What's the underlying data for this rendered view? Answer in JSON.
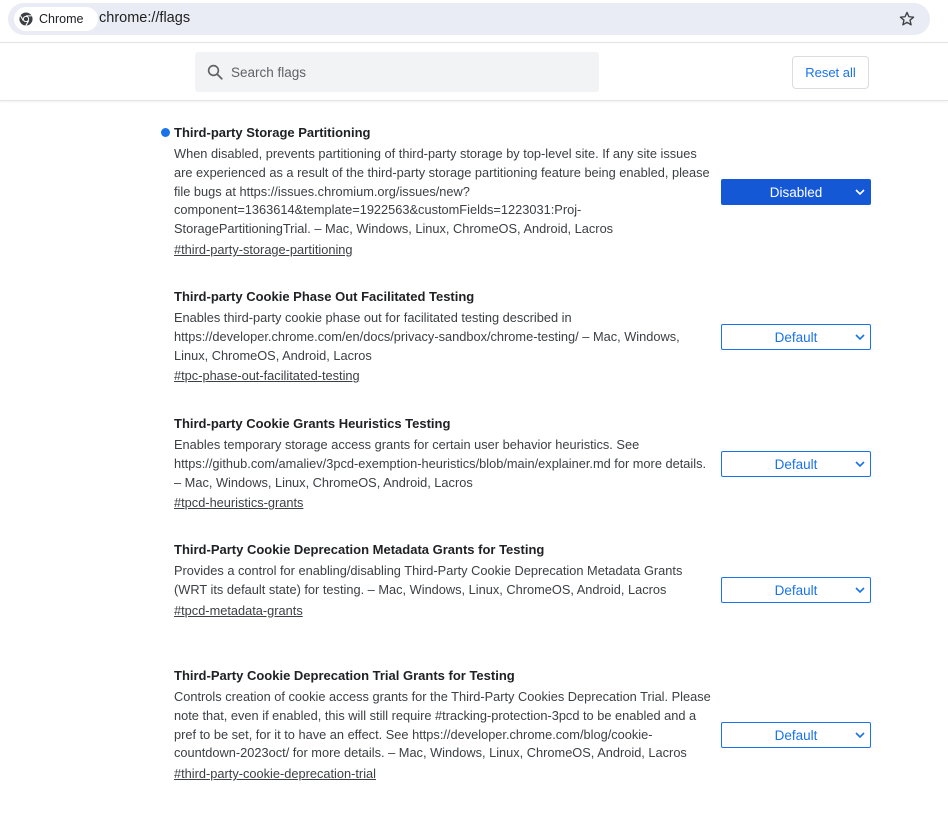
{
  "browser": {
    "chip_label": "Chrome",
    "url": "chrome://flags"
  },
  "search": {
    "placeholder": "Search flags",
    "value": ""
  },
  "toolbar": {
    "reset_label": "Reset all"
  },
  "colors": {
    "accent": "#1a73e8",
    "enabled_select": "#1558d6"
  },
  "experiments": [
    {
      "title": "Third-party Storage Partitioning",
      "description": "When disabled, prevents partitioning of third-party storage by top-level site. If any site issues are experienced as a result of the third-party storage partitioning feature being enabled, please file bugs at https://issues.chromium.org/issues/new?component=1363614&template=1922563&customFields=1223031:Proj-StoragePartitioningTrial. – Mac, Windows, Linux, ChromeOS, Android, Lacros",
      "link": "#third-party-storage-partitioning",
      "value": "Disabled",
      "modified": true
    },
    {
      "title": "Third-party Cookie Phase Out Facilitated Testing",
      "description": "Enables third-party cookie phase out for facilitated testing described in https://developer.chrome.com/en/docs/privacy-sandbox/chrome-testing/ – Mac, Windows, Linux, ChromeOS, Android, Lacros",
      "link": "#tpc-phase-out-facilitated-testing",
      "value": "Default",
      "modified": false
    },
    {
      "title": "Third-party Cookie Grants Heuristics Testing",
      "description": "Enables temporary storage access grants for certain user behavior heuristics. See https://github.com/amaliev/3pcd-exemption-heuristics/blob/main/explainer.md for more details. – Mac, Windows, Linux, ChromeOS, Android, Lacros",
      "link": "#tpcd-heuristics-grants",
      "value": "Default",
      "modified": false
    },
    {
      "title": "Third-Party Cookie Deprecation Metadata Grants for Testing",
      "description": "Provides a control for enabling/disabling Third-Party Cookie Deprecation Metadata Grants (WRT its default state) for testing. – Mac, Windows, Linux, ChromeOS, Android, Lacros",
      "link": "#tpcd-metadata-grants",
      "value": "Default",
      "modified": false
    },
    {
      "title": "Third-Party Cookie Deprecation Trial Grants for Testing",
      "description": "Controls creation of cookie access grants for the Third-Party Cookies Deprecation Trial. Please note that, even if enabled, this will still require #tracking-protection-3pcd to be enabled and a pref to be set, for it to have an effect. See https://developer.chrome.com/blog/cookie-countdown-2023oct/ for more details. – Mac, Windows, Linux, ChromeOS, Android, Lacros",
      "link": "#third-party-cookie-deprecation-trial",
      "value": "Default",
      "modified": false
    }
  ]
}
